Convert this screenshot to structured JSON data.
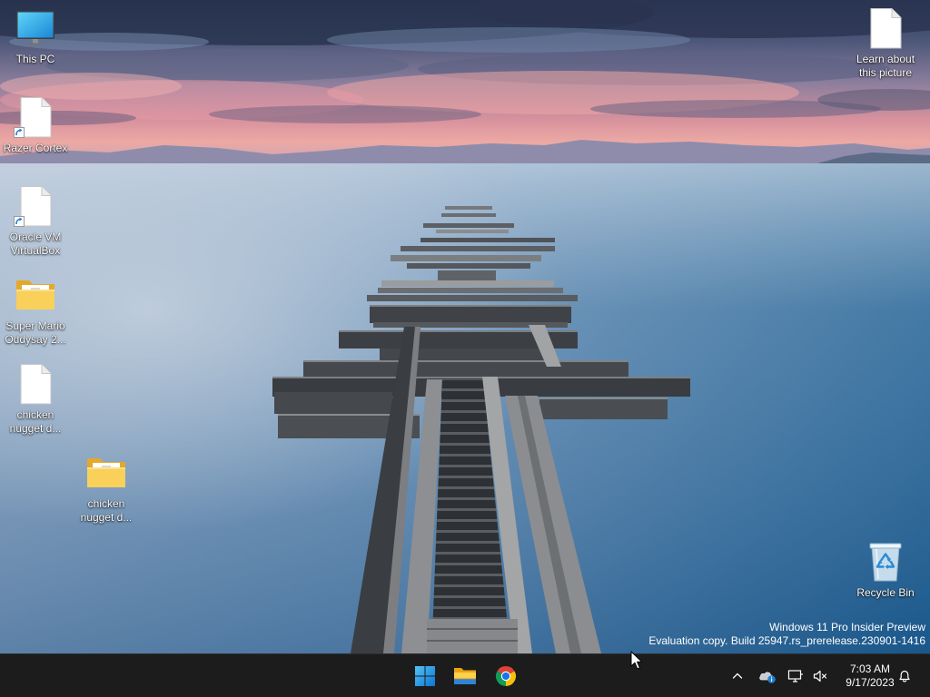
{
  "desktop": {
    "icons": {
      "this_pc": {
        "label": "This PC",
        "icon": "computer-icon"
      },
      "razer_cortex": {
        "label": "Razer Cortex",
        "icon": "shortcut-file-icon"
      },
      "oracle_vm_virtualbox": {
        "label": "Oracle VM VirtualBox",
        "icon": "shortcut-file-icon"
      },
      "super_mario_oddysay": {
        "label": "Super Mario Oddysay 2...",
        "icon": "folder-icon"
      },
      "chicken_nugget_file": {
        "label": "chicken nugget d...",
        "icon": "file-icon"
      },
      "chicken_nugget_folder": {
        "label": "chicken nugget d...",
        "icon": "folder-icon"
      },
      "learn_about_this_picture": {
        "label": "Learn about this picture",
        "icon": "file-icon"
      },
      "recycle_bin": {
        "label": "Recycle Bin",
        "icon": "recycle-bin-icon"
      }
    }
  },
  "watermark": {
    "edition": "Windows 11 Pro Insider Preview",
    "build": "Evaluation copy. Build 25947.rs_prerelease.230901-1416"
  },
  "taskbar": {
    "pinned_icons": [
      "windows-start-icon",
      "file-explorer-icon",
      "chrome-icon"
    ],
    "tray_icons": [
      "chevron-up-icon",
      "onedrive-icon",
      "network-icon",
      "volume-muted-icon"
    ],
    "clock": {
      "time": "7:03 AM",
      "date": "9/17/2023"
    },
    "notification_icon": "bell-icon"
  },
  "colors": {
    "taskbar_bg": "#1c1c1c",
    "start_blue": "#0a6fd0",
    "label_text": "#ffffff"
  }
}
